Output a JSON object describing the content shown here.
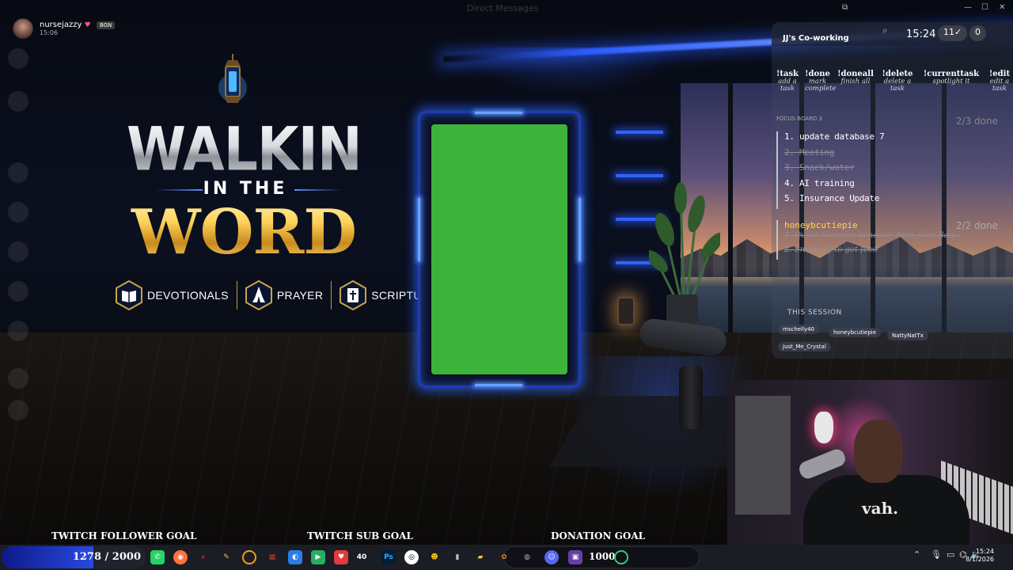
{
  "window": {
    "top_title": "Direct Messages"
  },
  "user": {
    "name": "nursejazzy",
    "badge": "BGN",
    "time": "15:06"
  },
  "title": {
    "line1": "WALKING",
    "line2": "IN THE",
    "line3": "WORD"
  },
  "badges": [
    {
      "label": "DEVOTIONALS",
      "icon": "book-icon"
    },
    {
      "label": "PRAYER",
      "icon": "praying-hands-icon"
    },
    {
      "label": "SCRIPTURE",
      "icon": "bible-icon"
    }
  ],
  "cowork": {
    "title": "JJ's Co-working",
    "time": "15:24",
    "count_badge": "11✓",
    "zero_badge": "0",
    "commands": [
      {
        "name": "!task",
        "desc": "add a task"
      },
      {
        "name": "!done",
        "desc": "mark complete"
      },
      {
        "name": "!doneall",
        "desc": "finish all"
      },
      {
        "name": "!delete",
        "desc": "delete a task"
      },
      {
        "name": "!currenttask",
        "desc": "spotlight it"
      },
      {
        "name": "!edit",
        "desc": "edit a task"
      }
    ],
    "board_label": "FOCUS BOARD 3",
    "board_done": "2/3 done",
    "tasks": [
      {
        "text": "1. update database 7",
        "done": false
      },
      {
        "text": "2. Meeting",
        "done": true
      },
      {
        "text": "3. Snack/water",
        "done": true
      },
      {
        "text": "4. AI training",
        "done": false
      },
      {
        "text": "5. Insurance Update",
        "done": false
      }
    ],
    "user2": {
      "name": "honeybcutiepie",
      "done": "2/2 done",
      "tasks": [
        "1. Quote Mannish behavior from John Ban...",
        "2. Sneak off to get food"
      ]
    },
    "session_label": "THIS SESSION",
    "session_users": [
      "mschelly40",
      "honeybcutiepie",
      "NattyNatTx",
      "Just_Me_Crystal"
    ]
  },
  "webcam": {
    "shirt_text": "vah."
  },
  "goals": {
    "follower": {
      "label": "TWITCH FOLLOWER GOAL",
      "progress": "1278 / 2000",
      "fraction": 0.639
    },
    "sub": {
      "label": "TWITCH SUB GOAL",
      "progress": "40"
    },
    "donation": {
      "label": "DONATION GOAL",
      "progress": "1000"
    }
  },
  "taskbar": {
    "time": "15:24",
    "date": "8/1/2026"
  },
  "colors": {
    "accent_blue": "#2a5cff",
    "green_screen": "#3cb43c",
    "gold": "#ffd35a"
  }
}
